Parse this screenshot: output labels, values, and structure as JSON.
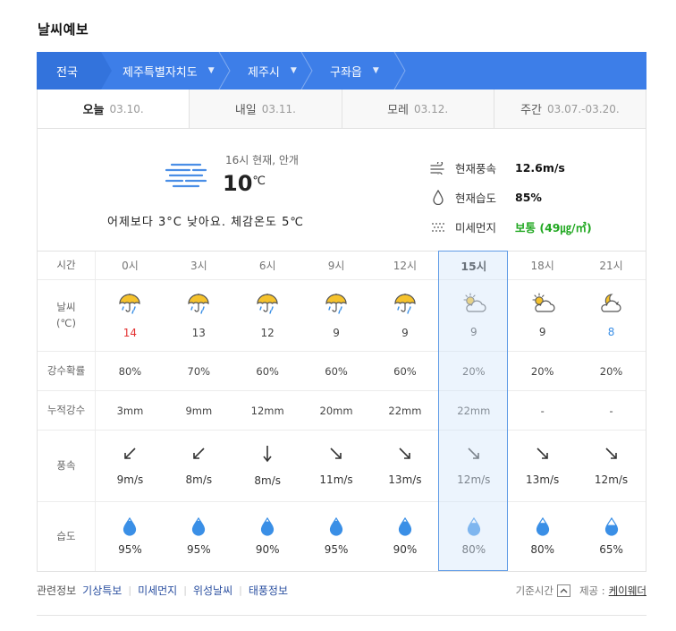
{
  "title": "날씨예보",
  "breadcrumb": [
    {
      "label": "전국"
    },
    {
      "label": "제주특별자치도"
    },
    {
      "label": "제주시"
    },
    {
      "label": "구좌읍"
    }
  ],
  "day_tabs": [
    {
      "label": "오늘",
      "date": "03.10."
    },
    {
      "label": "내일",
      "date": "03.11."
    },
    {
      "label": "모레",
      "date": "03.12."
    },
    {
      "label": "주간",
      "date": "03.07.-03.20."
    }
  ],
  "current": {
    "time_text": "16시 현재, 안개",
    "temp": "10",
    "temp_unit": "℃",
    "compare": "어제보다 3°C 낮아요. 체감온도 5℃",
    "wind_label": "현재풍속",
    "wind_value": "12.6m/s",
    "humidity_label": "현재습도",
    "humidity_value": "85%",
    "dust_label": "미세먼지",
    "dust_value": "보통 (49㎍/㎥)",
    "icon": "fog-icon"
  },
  "row_labels": {
    "time": "시간",
    "weather": "날씨",
    "weather_unit": "(℃)",
    "prob": "강수확률",
    "accum": "누적강수",
    "wind": "풍속",
    "humidity": "습도"
  },
  "hourly": [
    {
      "time": "0시",
      "icon": "rain-umbrella-icon",
      "temp": "14",
      "temp_color": "#e33333",
      "prob": "80%",
      "accum": "3mm",
      "wind_dir": "sw",
      "wind": "9m/s",
      "hum": "95%",
      "hum_fill": 0.95
    },
    {
      "time": "3시",
      "icon": "rain-umbrella-icon",
      "temp": "13",
      "temp_color": "#444444",
      "prob": "70%",
      "accum": "9mm",
      "wind_dir": "sw",
      "wind": "8m/s",
      "hum": "95%",
      "hum_fill": 0.95
    },
    {
      "time": "6시",
      "icon": "rain-umbrella-icon",
      "temp": "12",
      "temp_color": "#444444",
      "prob": "60%",
      "accum": "12mm",
      "wind_dir": "s",
      "wind": "8m/s",
      "hum": "90%",
      "hum_fill": 0.9
    },
    {
      "time": "9시",
      "icon": "rain-umbrella-icon",
      "temp": "9",
      "temp_color": "#444444",
      "prob": "60%",
      "accum": "20mm",
      "wind_dir": "se",
      "wind": "11m/s",
      "hum": "95%",
      "hum_fill": 0.95
    },
    {
      "time": "12시",
      "icon": "rain-umbrella-icon",
      "temp": "9",
      "temp_color": "#444444",
      "prob": "60%",
      "accum": "22mm",
      "wind_dir": "se",
      "wind": "13m/s",
      "hum": "90%",
      "hum_fill": 0.9
    },
    {
      "time": "15시",
      "icon": "partly-cloudy-day-icon",
      "temp": "9",
      "temp_color": "#444444",
      "prob": "20%",
      "accum": "22mm",
      "wind_dir": "se",
      "wind": "12m/s",
      "hum": "80%",
      "hum_fill": 0.8,
      "now": true
    },
    {
      "time": "18시",
      "icon": "partly-cloudy-day-icon",
      "temp": "9",
      "temp_color": "#444444",
      "prob": "20%",
      "accum": "-",
      "wind_dir": "se",
      "wind": "13m/s",
      "hum": "80%",
      "hum_fill": 0.8
    },
    {
      "time": "21시",
      "icon": "partly-cloudy-night-icon",
      "temp": "8",
      "temp_color": "#3a8fe6",
      "prob": "20%",
      "accum": "-",
      "wind_dir": "se",
      "wind": "12m/s",
      "hum": "65%",
      "hum_fill": 0.65
    }
  ],
  "footer": {
    "related_label": "관련정보",
    "links": [
      "기상특보",
      "미세먼지",
      "위성날씨",
      "태풍정보"
    ],
    "base_time_label": "기준시간",
    "provider_label": "제공 :",
    "provider": "케이웨더"
  }
}
